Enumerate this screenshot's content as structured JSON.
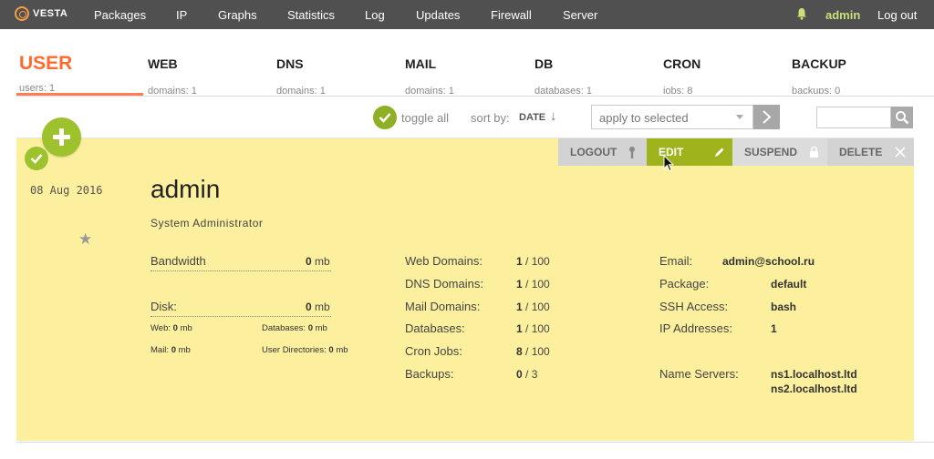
{
  "nav": {
    "logo": "VESTA",
    "items": [
      "Packages",
      "IP",
      "Graphs",
      "Statistics",
      "Log",
      "Updates",
      "Firewall",
      "Server"
    ],
    "user": "admin",
    "logout": "Log out"
  },
  "tabs": [
    {
      "title": "USER",
      "sub": "users:    1"
    },
    {
      "title": "WEB",
      "sub": "domains:    1"
    },
    {
      "title": "DNS",
      "sub": "domains:    1"
    },
    {
      "title": "MAIL",
      "sub": "domains:    1"
    },
    {
      "title": "DB",
      "sub": "databases:    1"
    },
    {
      "title": "CRON",
      "sub": "jobs:    8"
    },
    {
      "title": "BACKUP",
      "sub": "backups:    0"
    }
  ],
  "toolbar": {
    "toggle_all": "toggle all",
    "sort_by": "sort by:",
    "sort_value": "DATE",
    "sort_arrow": "↓",
    "apply_placeholder": "apply to selected",
    "search_placeholder": ""
  },
  "actions": {
    "logout": "LOGOUT",
    "edit": "EDIT",
    "suspend": "SUSPEND",
    "delete": "DELETE"
  },
  "user": {
    "created": "08 Aug 2016",
    "name": "admin",
    "fullname": "System Administrator",
    "bandwidth_label": "Bandwidth",
    "bandwidth_value": "0",
    "disk_label": "Disk:",
    "disk_value": "0",
    "unit": "mb",
    "web_label": "Web:",
    "web_value": "0",
    "databases_label": "Databases:",
    "databases_value": "0",
    "mail_label": "Mail:",
    "mail_value": "0",
    "userdirs_label": "User Directories:",
    "userdirs_value": "0"
  },
  "stats": [
    {
      "label": "Web Domains:",
      "used": "1",
      "limit": "/ 100"
    },
    {
      "label": "DNS Domains:",
      "used": "1",
      "limit": "/ 100"
    },
    {
      "label": "Mail Domains:",
      "used": "1",
      "limit": "/ 100"
    },
    {
      "label": "Databases:",
      "used": "1",
      "limit": "/ 100"
    },
    {
      "label": "Cron Jobs:",
      "used": "8",
      "limit": "/ 100"
    },
    {
      "label": "Backups:",
      "used": "0",
      "limit": "/ 3"
    }
  ],
  "info": {
    "email_label": "Email:",
    "email": "admin@school.ru",
    "package_label": "Package:",
    "package": "default",
    "ssh_label": "SSH Access:",
    "ssh": "bash",
    "ip_label": "IP Addresses:",
    "ip": "1",
    "ns_label": "Name Servers:",
    "ns1": "ns1.localhost.ltd",
    "ns2": "ns2.localhost.ltd"
  },
  "colors": {
    "accent_green": "#9dc22e",
    "user_orange": "#ff6a2f",
    "card_yellow": "#fcef9e",
    "nav_bg": "#505050"
  }
}
